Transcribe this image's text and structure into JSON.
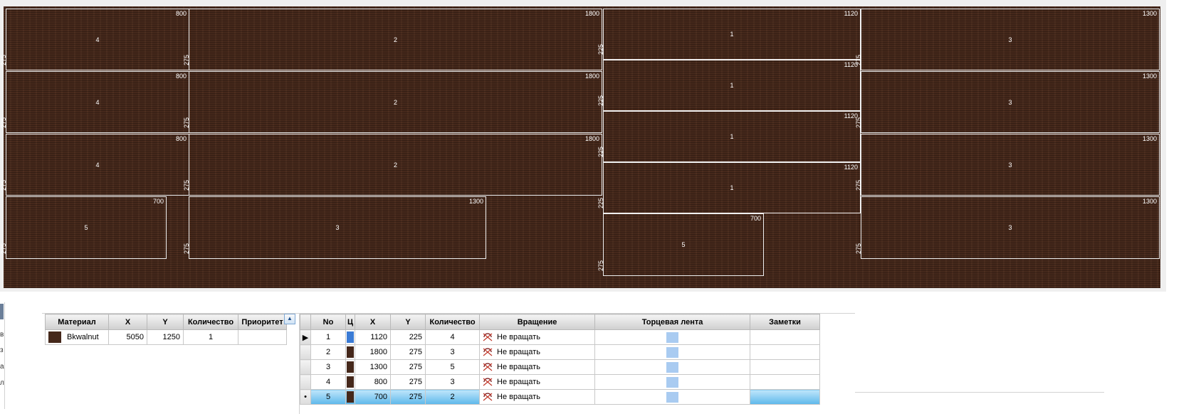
{
  "layout_pieces": [
    {
      "w": "800",
      "id": "4",
      "h": "275"
    },
    {
      "w": "1800",
      "id": "2",
      "h": "275"
    },
    {
      "w": "1120",
      "id": "1",
      "h": "225"
    },
    {
      "w": "1300",
      "id": "3",
      "h": "275"
    },
    {
      "w": "800",
      "id": "4",
      "h": "275"
    },
    {
      "w": "1800",
      "id": "2",
      "h": "275"
    },
    {
      "w": "1120",
      "id": "1",
      "h": "225"
    },
    {
      "w": "1300",
      "id": "3",
      "h": "275"
    },
    {
      "w": "800",
      "id": "4",
      "h": "275"
    },
    {
      "w": "1800",
      "id": "2",
      "h": "275"
    },
    {
      "w": "1120",
      "id": "1",
      "h": "225"
    },
    {
      "w": "1300",
      "id": "3",
      "h": "275"
    },
    {
      "w": "700",
      "id": "5",
      "h": "275"
    },
    {
      "w": "1300",
      "id": "3",
      "h": "275"
    },
    {
      "w": "1120",
      "id": "1",
      "h": "225"
    },
    {
      "w": "1300",
      "id": "3",
      "h": "275"
    },
    {
      "w": "700",
      "id": "5",
      "h": "275"
    }
  ],
  "materials_table": {
    "headers": [
      "Материал",
      "X",
      "Y",
      "Количество",
      "Приоритет"
    ],
    "rows": [
      {
        "material": "Bkwalnut",
        "x": "5050",
        "y": "1250",
        "qty": "1",
        "priority": ""
      }
    ]
  },
  "parts_table": {
    "headers": [
      "No",
      "Ц",
      "X",
      "Y",
      "Количество",
      "Вращение",
      "Торцевая лента",
      "Заметки"
    ],
    "rows": [
      {
        "no": "1",
        "x": "1120",
        "y": "225",
        "qty": "4",
        "rotation": "Не вращать",
        "notes": ""
      },
      {
        "no": "2",
        "x": "1800",
        "y": "275",
        "qty": "3",
        "rotation": "Не вращать",
        "notes": ""
      },
      {
        "no": "3",
        "x": "1300",
        "y": "275",
        "qty": "5",
        "rotation": "Не вращать",
        "notes": ""
      },
      {
        "no": "4",
        "x": "800",
        "y": "275",
        "qty": "3",
        "rotation": "Не вращать",
        "notes": ""
      },
      {
        "no": "5",
        "x": "700",
        "y": "275",
        "qty": "2",
        "rotation": "Не вращать",
        "notes": ""
      }
    ]
  },
  "left_stub_chars": [
    "в",
    "з",
    "а",
    "л"
  ],
  "colors": {
    "board": "#45281b",
    "selection": "#5db8ea",
    "edge_tape": "#a9cbf1"
  }
}
